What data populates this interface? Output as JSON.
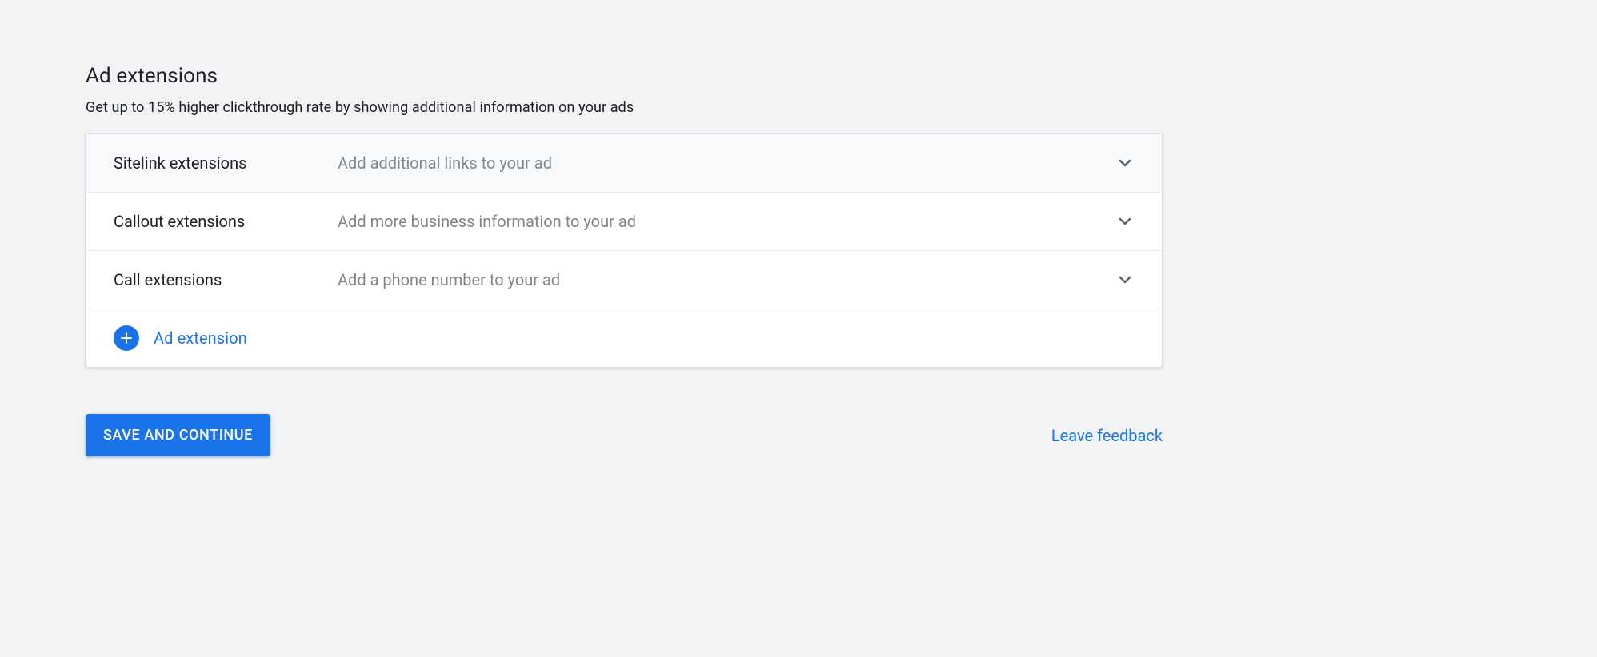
{
  "header": {
    "title": "Ad extensions",
    "subtitle": "Get up to 15% higher clickthrough rate by showing additional information on your ads"
  },
  "extensions": [
    {
      "label": "Sitelink extensions",
      "description": "Add additional links to your ad"
    },
    {
      "label": "Callout extensions",
      "description": "Add more business information to your ad"
    },
    {
      "label": "Call extensions",
      "description": "Add a phone number to your ad"
    }
  ],
  "add_extension_label": "Ad extension",
  "actions": {
    "save_label": "SAVE AND CONTINUE",
    "feedback_label": "Leave feedback"
  }
}
